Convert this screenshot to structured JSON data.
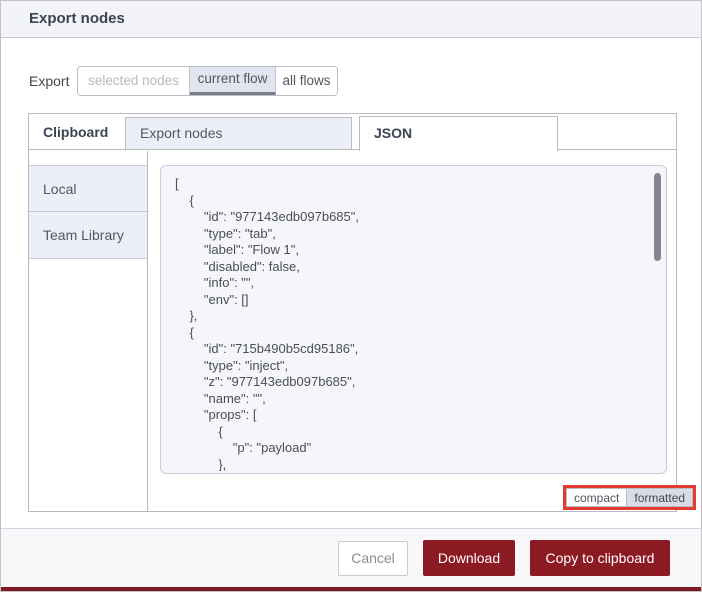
{
  "dialog": {
    "title": "Export nodes"
  },
  "export_scope": {
    "label": "Export",
    "options": [
      {
        "label": "selected nodes",
        "state": "disabled"
      },
      {
        "label": "current flow",
        "state": "selected"
      },
      {
        "label": "all flows",
        "state": "default"
      }
    ]
  },
  "library": {
    "header": "Clipboard",
    "tabs": [
      {
        "label": "Export nodes",
        "active": false
      },
      {
        "label": "JSON",
        "active": true
      }
    ],
    "sidebar_items": [
      {
        "label": "Local"
      },
      {
        "label": "Team Library"
      }
    ]
  },
  "editor": {
    "json_text": "[\n    {\n        \"id\": \"977143edb097b685\",\n        \"type\": \"tab\",\n        \"label\": \"Flow 1\",\n        \"disabled\": false,\n        \"info\": \"\",\n        \"env\": []\n    },\n    {\n        \"id\": \"715b490b5cd95186\",\n        \"type\": \"inject\",\n        \"z\": \"977143edb097b685\",\n        \"name\": \"\",\n        \"props\": [\n            {\n                \"p\": \"payload\"\n            },",
    "format_toggle": {
      "compact_label": "compact",
      "formatted_label": "formatted",
      "selected": "formatted"
    },
    "scrollbar": "vertical"
  },
  "footer": {
    "cancel_label": "Cancel",
    "download_label": "Download",
    "copy_label": "Copy to clipboard"
  },
  "colors": {
    "header_bg": "#f3f3fa",
    "selected_segment_bg": "#e2e4f0",
    "inactive_tab_bg": "#eceef8",
    "sidebar_item_bg": "#edeff8",
    "editor_bg": "#f5f6fb",
    "primary_button_bg": "#8c1a22",
    "annotation_highlight": "#e23b2f",
    "bottom_strip": "#7e1a23"
  }
}
